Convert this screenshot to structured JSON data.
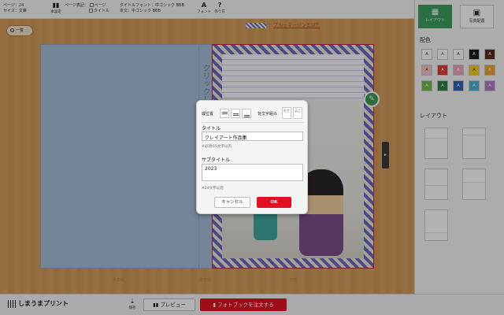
{
  "toolbar": {
    "page_label": "ページ：24",
    "size_label": "サイズ：文庫",
    "book_settings_label": "本設定",
    "page_display_label": "ページ表記：",
    "page_option": "ページ",
    "title_option": "タイトル",
    "title_font_label": "タイトルフォント：中ゴシック BBB",
    "body_font_label": "本文：中ゴシック BBB",
    "font_button_label": "フォント",
    "guide_button_label": "作り方"
  },
  "workspace": {
    "back_button_label": "一覧",
    "bleed_note_prefix": "：",
    "bleed_note_link": "ブルーマージンとは？",
    "spine_text": "クリックして",
    "labels": {
      "back_cover": "裏表紙",
      "spine": "背表紙",
      "front_cover": "表紙"
    }
  },
  "dialog": {
    "position_label": "縦位置",
    "spine_direction_label": "背文字組み",
    "dir_horizontal": "よこ",
    "dir_vertical": "たて",
    "title_label": "タイトル",
    "title_value": "クレイアート作品集",
    "title_hint": "※必須/15文字以内",
    "subtitle_label": "サブタイトル",
    "subtitle_value": "2023",
    "subtitle_hint": "※24文字以内",
    "cancel_label": "キャンセル",
    "ok_label": "OK"
  },
  "right_panel": {
    "tab_layout": "レイアウト",
    "tab_photo": "写真配置",
    "color_heading": "配色",
    "layout_heading": "レイアウト",
    "swatch_text": "A",
    "swatches": [
      {
        "bg": "#ffffff",
        "fg": "#333333"
      },
      {
        "bg": "#ffffff",
        "fg": "#3d6fbf"
      },
      {
        "bg": "#ffffff",
        "fg": "#333333"
      },
      {
        "bg": "#1d1d1d",
        "fg": "#ffffff"
      },
      {
        "bg": "#5a2c1e",
        "fg": "#ffffff"
      },
      {
        "bg": "#f2c4c4",
        "fg": "#b02828"
      },
      {
        "bg": "#e43b3b",
        "fg": "#ffffff"
      },
      {
        "bg": "#f3a7bd",
        "fg": "#ffffff"
      },
      {
        "bg": "#f6d31a",
        "fg": "#333333"
      },
      {
        "bg": "#f2a531",
        "fg": "#ffffff"
      },
      {
        "bg": "#6fbf4a",
        "fg": "#ffffff"
      },
      {
        "bg": "#2f7f45",
        "fg": "#ffffff"
      },
      {
        "bg": "#2e64b8",
        "fg": "#ffffff"
      },
      {
        "bg": "#47b7d6",
        "fg": "#ffffff"
      },
      {
        "bg": "#b27ac9",
        "fg": "#ffffff"
      }
    ]
  },
  "bottom": {
    "brand": "しまうまプリント",
    "save_label": "保存",
    "preview_label": "プレビュー",
    "order_label": "フォトブックを注文する"
  },
  "colors": {
    "accent_green": "#3c9f5e",
    "order_red": "#e11421",
    "bleed_purple": "#6b6bc7"
  }
}
